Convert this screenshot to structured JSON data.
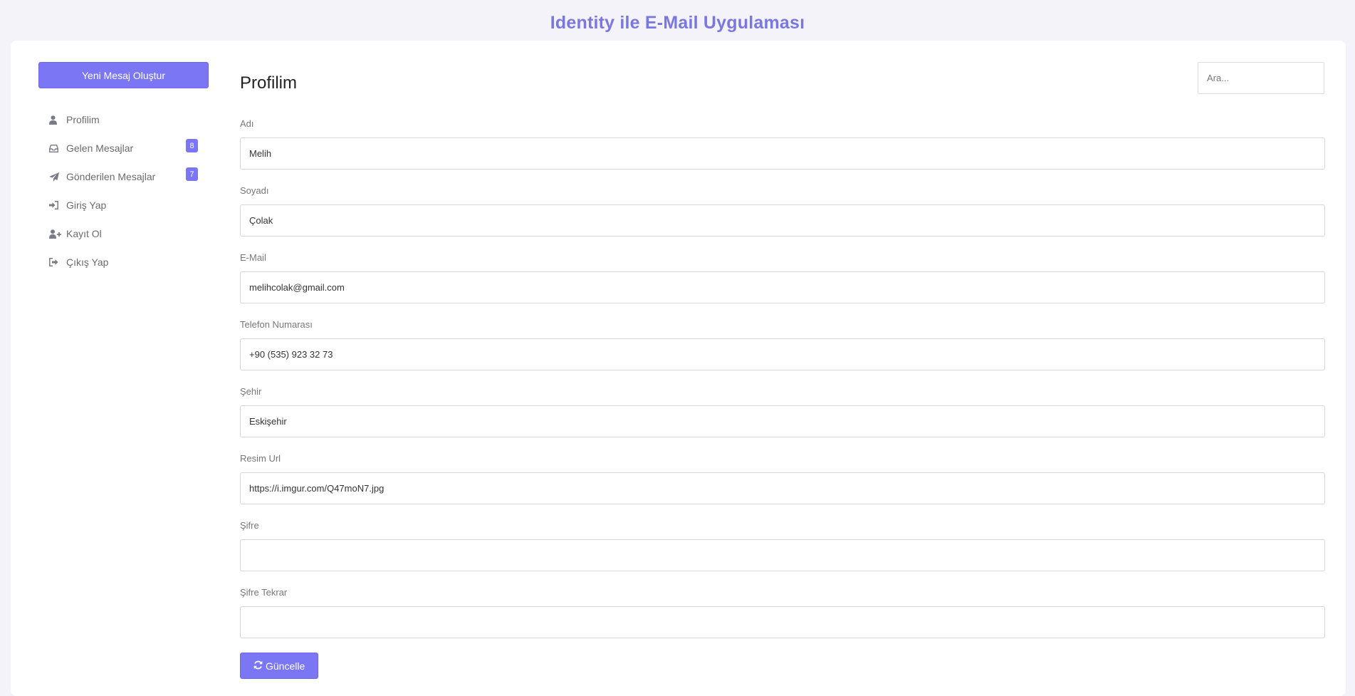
{
  "app": {
    "title": "Identity ile E-Mail Uygulaması",
    "accent_color": "#7b76f4",
    "background_color": "#f3f3f9"
  },
  "sidebar": {
    "new_message_label": "Yeni Mesaj Oluştur",
    "items": [
      {
        "label": "Profilim",
        "icon": "user-icon"
      },
      {
        "label": "Gelen Mesajlar",
        "icon": "inbox-icon",
        "badge": "8"
      },
      {
        "label": "Gönderilen Mesajlar",
        "icon": "paper-plane-icon",
        "badge": "7"
      },
      {
        "label": "Giriş Yap",
        "icon": "sign-in-icon"
      },
      {
        "label": "Kayıt Ol",
        "icon": "user-plus-icon"
      },
      {
        "label": "Çıkış Yap",
        "icon": "sign-out-icon"
      }
    ]
  },
  "main": {
    "title": "Profilim",
    "search": {
      "placeholder": "Ara..."
    },
    "fields": [
      {
        "label": "Adı",
        "value": "Melih"
      },
      {
        "label": "Soyadı",
        "value": "Çolak"
      },
      {
        "label": "E-Mail",
        "value": "melihcolak@gmail.com"
      },
      {
        "label": "Telefon Numarası",
        "value": "+90 (535) 923 32 73"
      },
      {
        "label": "Şehir",
        "value": "Eskişehir"
      },
      {
        "label": "Resim Url",
        "value": "https://i.imgur.com/Q47moN7.jpg"
      },
      {
        "label": "Şifre",
        "value": ""
      },
      {
        "label": "Şifre Tekrar",
        "value": ""
      }
    ],
    "update_button": {
      "label": "Güncelle",
      "icon": "refresh-icon"
    }
  }
}
